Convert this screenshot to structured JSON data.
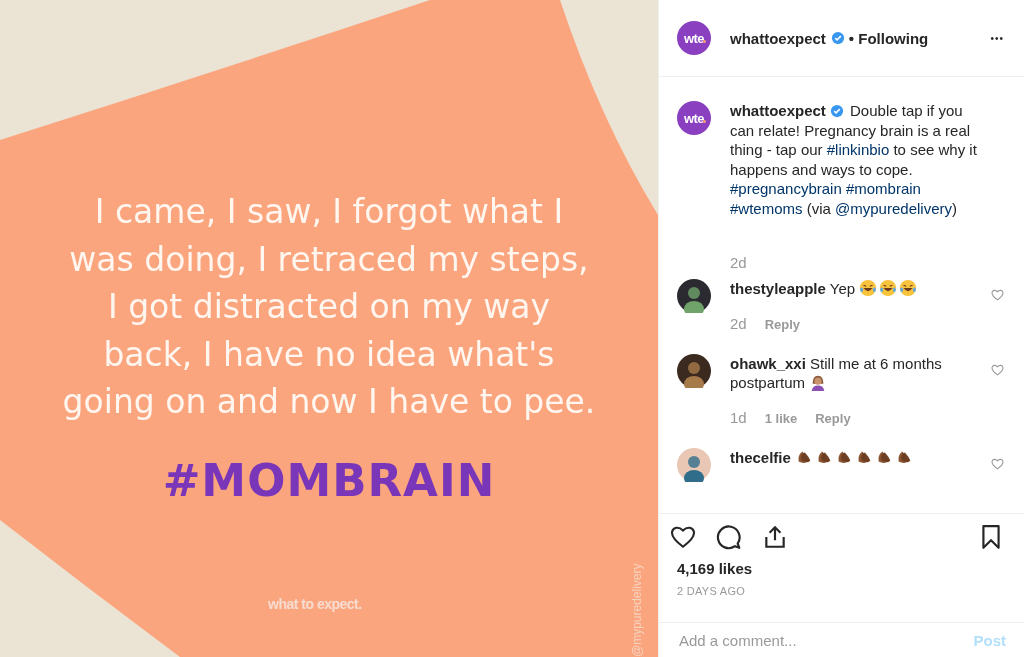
{
  "post_image": {
    "quote_lines": [
      "I came, I saw, I forgot what I",
      "was doing, I retraced my steps,",
      "I got distracted on my way",
      "back, I have no idea what's",
      "going on and now I have to pee."
    ],
    "hashtag": "#MOMBRAIN",
    "brand": "what to expect.",
    "credit": "@mypuredelivery"
  },
  "header": {
    "avatar_text": "wte",
    "username": "whattoexpect",
    "verified": true,
    "following": "• Following",
    "more": "•••"
  },
  "caption": {
    "avatar_text": "wte",
    "username": "whattoexpect",
    "verified": true,
    "parts": [
      {
        "kind": "text",
        "text": "Double tap if you can relate! Pregnancy brain is a real thing - tap our "
      },
      {
        "kind": "link",
        "text": "#linkinbio"
      },
      {
        "kind": "text",
        "text": " to see why it happens and ways to cope. "
      },
      {
        "kind": "link",
        "text": "#pregnancybrain"
      },
      {
        "kind": "link",
        "text": "#mombrain"
      },
      {
        "kind": "link",
        "text": "#wtemoms"
      },
      {
        "kind": "text",
        "text": " (via "
      },
      {
        "kind": "link",
        "text": "@mypuredelivery"
      },
      {
        "kind": "text",
        "text": ")"
      }
    ],
    "time": "2d"
  },
  "comments": [
    {
      "kind": "laughing",
      "username": "thestyleapple",
      "text": "Yep",
      "time": "2d",
      "reply": "Reply"
    },
    {
      "kind": "person",
      "username": "ohawk_xxi",
      "text": "Still me at 6 months postpartum",
      "time": "1d",
      "likes": "1 like",
      "reply": "Reply"
    },
    {
      "kind": "clapping",
      "username": "thecelfie"
    }
  ],
  "likes": "4,169 likes",
  "date": "2 DAYS AGO",
  "comment_field": {
    "placeholder": "Add a comment...",
    "post": "Post"
  }
}
